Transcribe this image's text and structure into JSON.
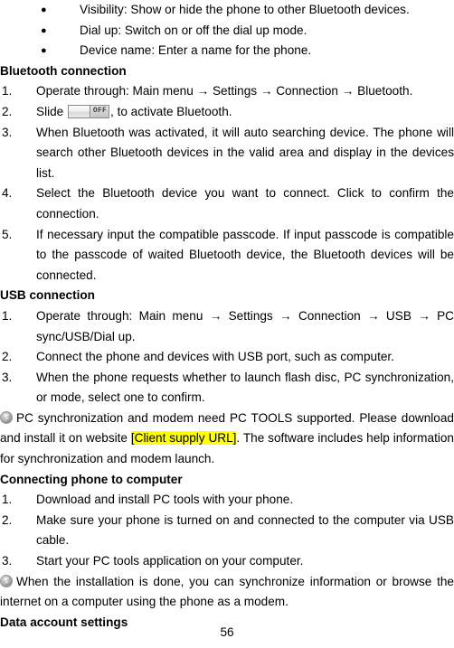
{
  "document": {
    "page_number": "56",
    "highlight_color": "#ffff00",
    "arrow_glyph": "→",
    "bullet_glyph": "●"
  },
  "bullets": [
    {
      "text": "Visibility: Show or hide the phone to other Bluetooth devices."
    },
    {
      "text": "Dial up: Switch on or off the dial up mode."
    },
    {
      "text": "Device name: Enter a name for the phone."
    }
  ],
  "sections": [
    {
      "heading": "Bluetooth connection",
      "items": [
        {
          "marker": "1.",
          "text": "Operate through: Main menu → Settings → Connection → Bluetooth."
        },
        {
          "marker": "2.",
          "text_before": "Slide",
          "widget": "toggle-off-switch",
          "widget_label": "OFF",
          "text_after": ", to activate Bluetooth."
        },
        {
          "marker": "3.",
          "text": "When Bluetooth was activated, it will auto searching device. The phone will search other Bluetooth devices in the valid area and display in the devices list."
        },
        {
          "marker": "4.",
          "text": "Select the Bluetooth device you want to connect. Click to confirm the connection."
        },
        {
          "marker": "5.",
          "text": "If necessary input the compatible passcode. If input passcode is compatible to the passcode of waited Bluetooth device, the Bluetooth devices will be connected."
        }
      ]
    },
    {
      "heading": "USB connection",
      "items": [
        {
          "marker": "1.",
          "text": "Operate through: Main menu → Settings → Connection → USB → PC sync/USB/Dial up."
        },
        {
          "marker": "2.",
          "text": "Connect the phone and devices with USB port, such as computer."
        },
        {
          "marker": "3.",
          "text": "When the phone requests whether to launch flash disc, PC synchronization, or mode, select one to confirm."
        }
      ]
    }
  ],
  "notes": [
    {
      "icon": "note-info-icon",
      "text_before": "PC synchronization and modem need PC TOOLS supported. Please download and install it on website ",
      "highlighted": "[Client supply URL]",
      "text_after": ". The software includes help information for synchronization and modem launch."
    },
    {
      "icon": "note-info-icon",
      "text_before": "When the installation is done, you can synchronize information or browse the internet on a computer using the phone as a modem.",
      "highlighted": "",
      "text_after": ""
    }
  ],
  "computer_section": {
    "heading": "Connecting phone to computer",
    "items": [
      {
        "marker": "1.",
        "text": "Download and install PC tools with your phone."
      },
      {
        "marker": "2.",
        "text": "Make sure your phone is turned on and connected to the computer via USB cable."
      },
      {
        "marker": "3.",
        "text": "Start your PC tools application on your computer."
      }
    ]
  },
  "final_heading": "Data account settings"
}
